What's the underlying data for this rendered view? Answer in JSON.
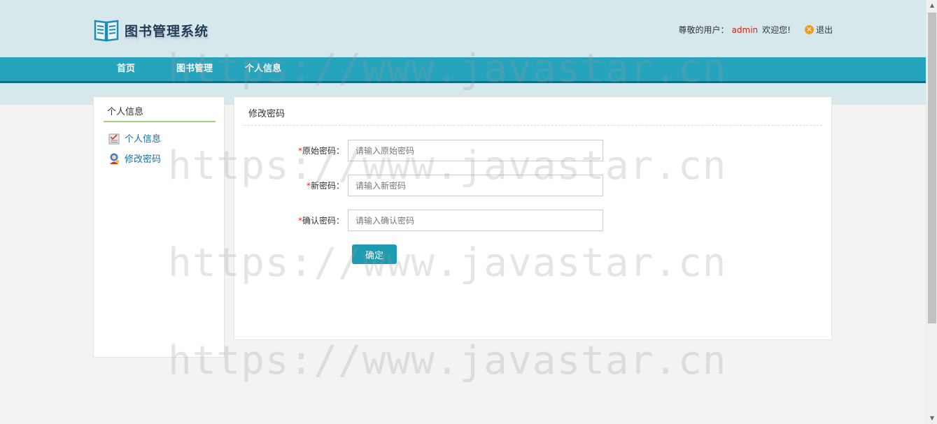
{
  "header": {
    "app_title": "图书管理系统",
    "greeting_prefix": "尊敬的用户：",
    "username": "admin",
    "greeting_suffix": "欢迎您!",
    "logout_label": "退出"
  },
  "nav": {
    "items": [
      {
        "label": "首页"
      },
      {
        "label": "图书管理"
      },
      {
        "label": "个人信息"
      }
    ]
  },
  "sidebar": {
    "title": "个人信息",
    "items": [
      {
        "label": "个人信息",
        "icon": "profile-doc-icon"
      },
      {
        "label": "修改密码",
        "icon": "user-key-icon"
      }
    ]
  },
  "main": {
    "title": "修改密码",
    "form": {
      "required_mark": "*",
      "fields": [
        {
          "label": "原始密码：",
          "placeholder": "请输入原始密码",
          "value": ""
        },
        {
          "label": "新密码：",
          "placeholder": "请输入新密码",
          "value": ""
        },
        {
          "label": "确认密码：",
          "placeholder": "请输入确认密码",
          "value": ""
        }
      ],
      "submit_label": "确定"
    }
  },
  "watermark": "https://www.javastar.cn",
  "colors": {
    "nav_bg": "#26a4bd",
    "header_bg": "#d6e8ec",
    "accent_button": "#1d9bb3",
    "username": "#dd1111",
    "required": "#ee2222"
  }
}
